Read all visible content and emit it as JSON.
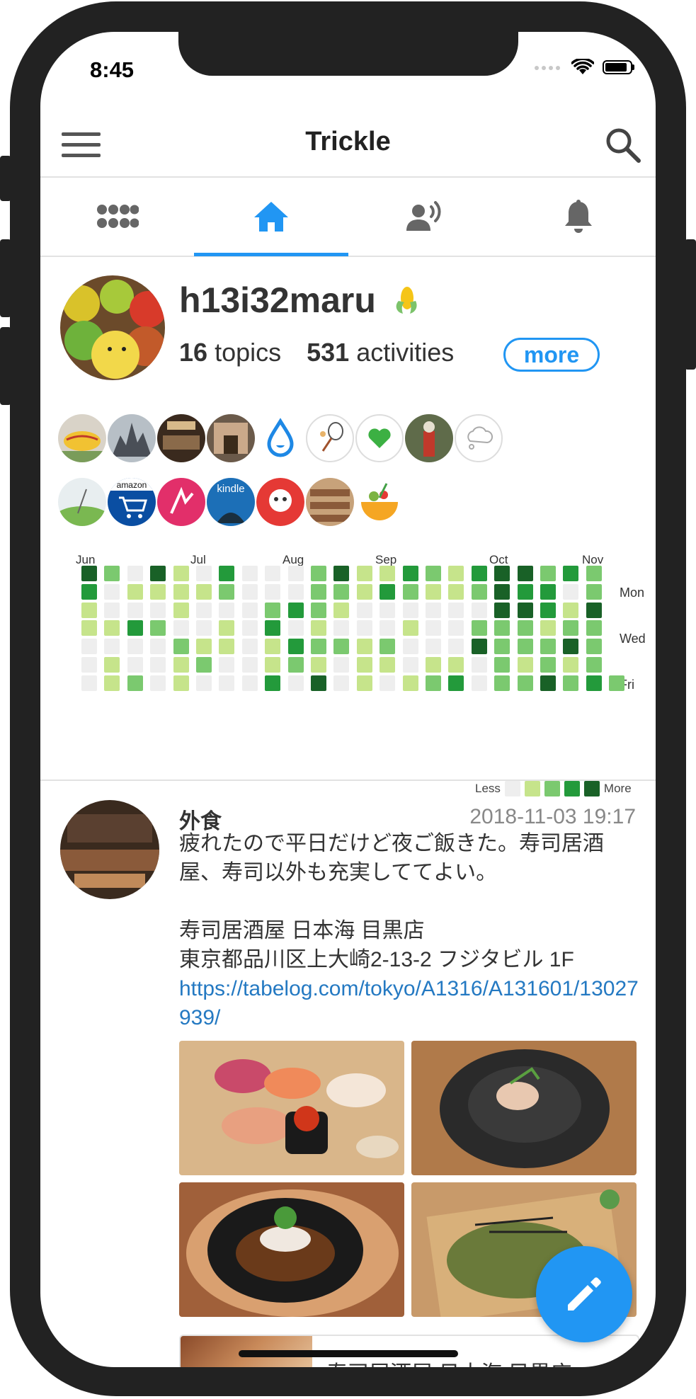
{
  "status_bar": {
    "time": "8:45"
  },
  "header": {
    "title": "Trickle"
  },
  "tabs": [
    {
      "name": "grid-apps-icon",
      "active": false
    },
    {
      "name": "home-icon",
      "active": true
    },
    {
      "name": "speaking-person-icon",
      "active": false
    },
    {
      "name": "bell-icon",
      "active": false
    }
  ],
  "profile": {
    "username": "h13i32maru",
    "badge_icon": "corn-icon",
    "topics_count": "16",
    "topics_label": "topics",
    "activities_count": "531",
    "activities_label": "activities",
    "more_label": "more"
  },
  "heatmap": {
    "months": [
      "Jun",
      "Jul",
      "Aug",
      "Sep",
      "Oct",
      "Nov"
    ],
    "day_labels": [
      "Mon",
      "Wed",
      "Fri"
    ],
    "legend_less": "Less",
    "legend_more": "More",
    "colors": [
      "#eeeeee",
      "#c6e48b",
      "#7bc96f",
      "#239a3b",
      "#196127"
    ],
    "levels": [
      [
        4,
        2,
        0,
        4,
        1,
        0,
        3,
        0,
        0,
        0,
        2,
        4,
        1,
        1,
        3,
        2,
        1,
        3,
        4,
        4,
        2,
        3,
        2
      ],
      [
        3,
        0,
        1,
        1,
        1,
        1,
        2,
        0,
        0,
        0,
        2,
        2,
        1,
        3,
        2,
        1,
        1,
        2,
        4,
        3,
        3,
        0,
        2
      ],
      [
        1,
        0,
        0,
        0,
        1,
        0,
        0,
        0,
        2,
        3,
        2,
        1,
        0,
        0,
        0,
        0,
        0,
        0,
        4,
        4,
        3,
        1,
        4
      ],
      [
        1,
        1,
        3,
        2,
        0,
        0,
        1,
        0,
        3,
        0,
        1,
        0,
        0,
        0,
        1,
        0,
        0,
        2,
        2,
        2,
        1,
        2,
        2
      ],
      [
        0,
        0,
        0,
        0,
        2,
        1,
        1,
        0,
        1,
        3,
        2,
        2,
        1,
        2,
        0,
        0,
        0,
        4,
        2,
        2,
        2,
        4,
        2
      ],
      [
        0,
        1,
        0,
        0,
        1,
        2,
        0,
        0,
        1,
        2,
        1,
        0,
        1,
        1,
        0,
        1,
        1,
        0,
        2,
        1,
        2,
        1,
        2
      ],
      [
        0,
        1,
        2,
        0,
        1,
        0,
        0,
        0,
        3,
        0,
        4,
        0,
        1,
        0,
        1,
        2,
        3,
        0,
        2,
        2,
        4,
        2,
        3,
        2
      ]
    ]
  },
  "post": {
    "author": "外食",
    "timestamp": "2018-11-03 19:17",
    "text_line1": "疲れたので平日だけど夜ご飯きた。寿司居酒屋、寿司以外も充実しててよい。",
    "place_name": "寿司居酒屋 日本海 目黒店",
    "address": "東京都品川区上大崎2-13-2 フジタビル 1F",
    "url": "https://tabelog.com/tokyo/A1316/A131601/13027939/",
    "link_card_text": "寿司居酒屋 日本海 目黒店"
  },
  "fab": {
    "icon": "pencil-icon"
  },
  "accent_color": "#2196f3"
}
